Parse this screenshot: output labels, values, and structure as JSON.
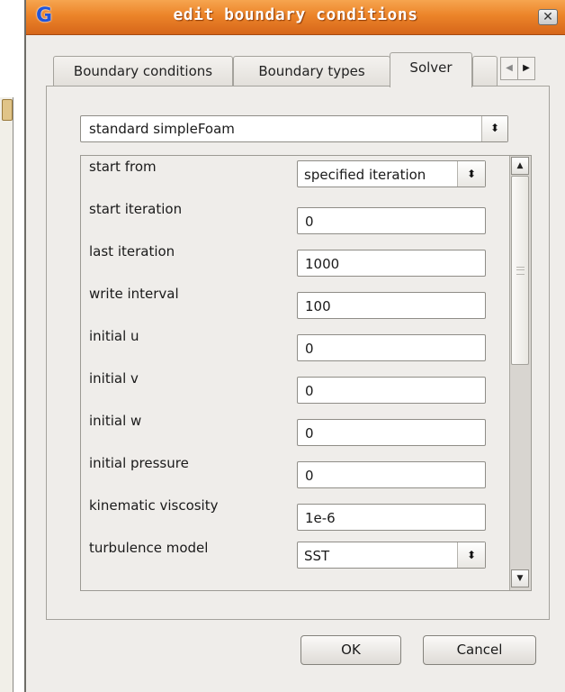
{
  "window": {
    "title": "edit boundary conditions",
    "close_symbol": "✕",
    "app_icon_glyph": "G"
  },
  "tabs": [
    {
      "label": "Boundary conditions",
      "active": false
    },
    {
      "label": "Boundary types",
      "active": false
    },
    {
      "label": "Solver",
      "active": true
    }
  ],
  "tab_scroll": {
    "left_glyph": "◀",
    "right_glyph": "▶"
  },
  "solver_select": {
    "value": "standard simpleFoam",
    "arrows": "⬍"
  },
  "fields": {
    "start_from": {
      "label": "start from",
      "value": "specified iteration",
      "arrows": "⬍"
    },
    "start_iteration": {
      "label": "start iteration",
      "value": "0"
    },
    "last_iteration": {
      "label": "last iteration",
      "value": "1000"
    },
    "write_interval": {
      "label": "write interval",
      "value": "100"
    },
    "initial_u": {
      "label": "initial u",
      "value": "0"
    },
    "initial_v": {
      "label": "initial v",
      "value": "0"
    },
    "initial_w": {
      "label": "initial w",
      "value": "0"
    },
    "initial_pressure": {
      "label": "initial pressure",
      "value": "0"
    },
    "kinematic_viscosity": {
      "label": "kinematic viscosity",
      "value": "1e-6"
    },
    "turbulence_model": {
      "label": "turbulence model",
      "value": "SST",
      "arrows": "⬍"
    }
  },
  "scrollbar": {
    "up_glyph": "▲",
    "down_glyph": "▼"
  },
  "buttons": {
    "ok": "OK",
    "cancel": "Cancel"
  },
  "colors": {
    "titlebar": "#ec8429",
    "title_text": "#ffffff",
    "dialog_bg": "#efedea"
  }
}
